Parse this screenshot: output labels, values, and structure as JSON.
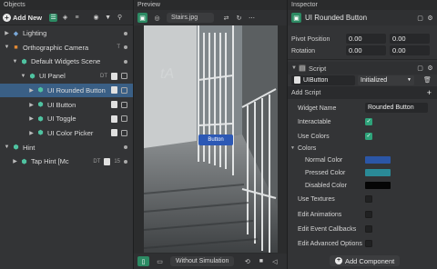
{
  "objects": {
    "title": "Objects",
    "add_label": "Add New",
    "tree": [
      {
        "label": "Lighting",
        "indent": 0,
        "expanded": false,
        "icon": "lighting-icon",
        "color": "#7aa8d8"
      },
      {
        "label": "Orthographic Camera",
        "indent": 0,
        "expanded": true,
        "icon": "camera-icon",
        "color": "#e28a35",
        "badge": "T"
      },
      {
        "label": "Default Widgets Scene",
        "indent": 1,
        "expanded": true,
        "icon": "cube-icon",
        "color": "#4fc3a1"
      },
      {
        "label": "UI Panel",
        "indent": 2,
        "expanded": true,
        "icon": "cube-icon",
        "color": "#4fc3a1",
        "badge": "DT"
      },
      {
        "label": "UI Rounded Button",
        "indent": 3,
        "expanded": false,
        "icon": "cube-icon",
        "color": "#4fc3a1",
        "selected": true
      },
      {
        "label": "UI Button",
        "indent": 3,
        "expanded": false,
        "icon": "cube-icon",
        "color": "#4fc3a1"
      },
      {
        "label": "UI Toggle",
        "indent": 3,
        "expanded": false,
        "icon": "cube-icon",
        "color": "#4fc3a1"
      },
      {
        "label": "UI Color Picker",
        "indent": 3,
        "expanded": false,
        "icon": "cube-icon",
        "color": "#4fc3a1"
      },
      {
        "label": "Hint",
        "indent": 0,
        "expanded": true,
        "icon": "cube-icon",
        "color": "#4fc3a1"
      },
      {
        "label": "Tap Hint [Mc",
        "indent": 1,
        "expanded": false,
        "icon": "cube-icon",
        "color": "#4fc3a1",
        "badge": "DT",
        "badge2": "15"
      }
    ]
  },
  "preview": {
    "title": "Preview",
    "file": "Stairs.jpg",
    "button_label": "Button",
    "sim_label": "Without Simulation"
  },
  "inspector": {
    "title": "Inspector",
    "object_name": "UI Rounded Button",
    "pivot_label": "Pivot Position",
    "pivot_x": "0.00",
    "pivot_y": "0.00",
    "rotation_label": "Rotation",
    "rotation_x": "0.00",
    "rotation_y": "0.00",
    "script_header": "Script",
    "script_name": "UIButton",
    "script_state": "Initialized",
    "add_script": "Add Script",
    "widget_name_label": "Widget Name",
    "widget_name_value": "Rounded Button",
    "interactable_label": "Interactable",
    "use_colors_label": "Use Colors",
    "colors_label": "Colors",
    "normal_label": "Normal Color",
    "normal_color": "#2b56a6",
    "pressed_label": "Pressed Color",
    "pressed_color": "#2a8a97",
    "disabled_label": "Disabled Color",
    "disabled_color": "#050505",
    "use_textures_label": "Use Textures",
    "edit_animations_label": "Edit Animations",
    "edit_callbacks_label": "Edit Event Callbacks",
    "edit_advanced_label": "Edit Advanced Options",
    "add_component": "Add Component"
  }
}
